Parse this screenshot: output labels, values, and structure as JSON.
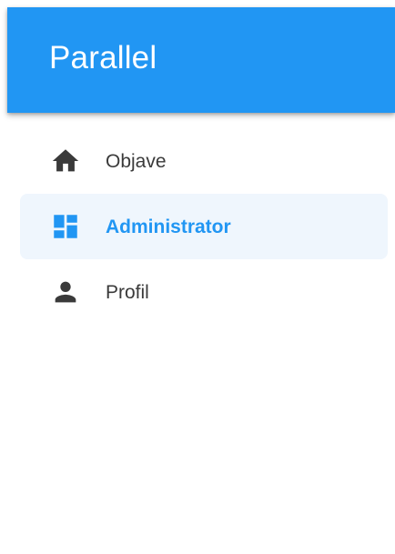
{
  "app": {
    "title": "Parallel"
  },
  "colors": {
    "accent": "#2196f3",
    "active_background": "#eff6fd",
    "icon_default": "#3a3a3a",
    "text_default": "#3a3a3a"
  },
  "nav": {
    "items": [
      {
        "label": "Objave",
        "icon": "home-icon",
        "active": false
      },
      {
        "label": "Administrator",
        "icon": "dashboard-icon",
        "active": true
      },
      {
        "label": "Profil",
        "icon": "person-icon",
        "active": false
      }
    ]
  }
}
